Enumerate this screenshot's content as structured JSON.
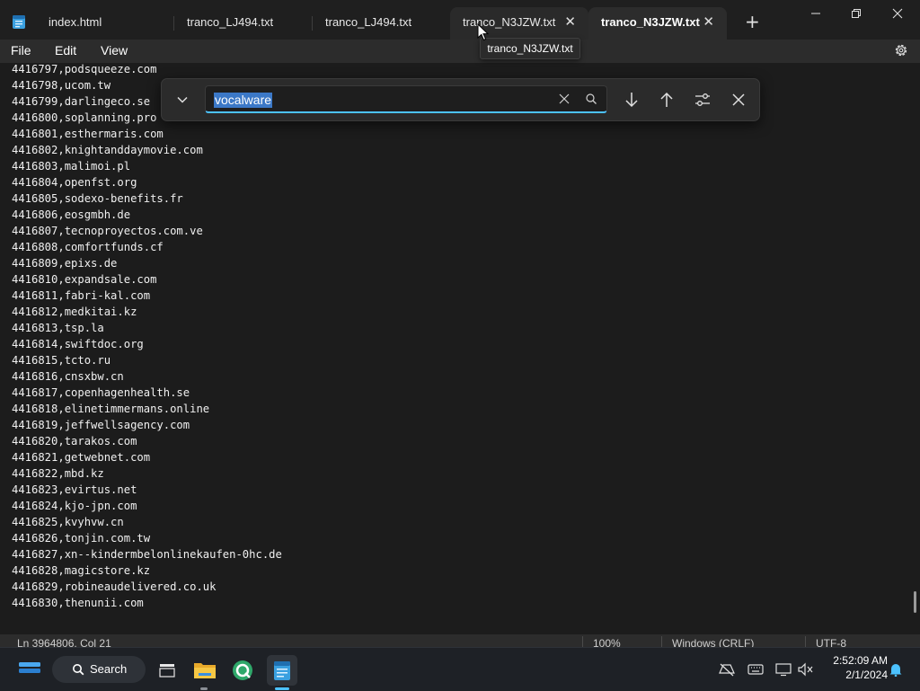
{
  "tabs": [
    {
      "label": "index.html"
    },
    {
      "label": "tranco_LJ494.txt"
    },
    {
      "label": "tranco_LJ494.txt"
    },
    {
      "label": "tranco_N3JZW.txt"
    },
    {
      "label": "tranco_N3JZW.txt"
    }
  ],
  "tooltip": "tranco_N3JZW.txt",
  "menu": {
    "file": "File",
    "edit": "Edit",
    "view": "View"
  },
  "find": {
    "query": "vocalware"
  },
  "lines": [
    "4416797,podsqueeze.com",
    "4416798,ucom.tw",
    "4416799,darlingeco.se",
    "4416800,soplanning.pro",
    "4416801,esthermaris.com",
    "4416802,knightanddaymovie.com",
    "4416803,malimoi.pl",
    "4416804,openfst.org",
    "4416805,sodexo-benefits.fr",
    "4416806,eosgmbh.de",
    "4416807,tecnoproyectos.com.ve",
    "4416808,comfortfunds.cf",
    "4416809,epixs.de",
    "4416810,expandsale.com",
    "4416811,fabri-kal.com",
    "4416812,medkitai.kz",
    "4416813,tsp.la",
    "4416814,swiftdoc.org",
    "4416815,tcto.ru",
    "4416816,cnsxbw.cn",
    "4416817,copenhagenhealth.se",
    "4416818,elinetimmermans.online",
    "4416819,jeffwellsagency.com",
    "4416820,tarakos.com",
    "4416821,getwebnet.com",
    "4416822,mbd.kz",
    "4416823,evirtus.net",
    "4416824,kjo-jpn.com",
    "4416825,kvyhvw.cn",
    "4416826,tonjin.com.tw",
    "4416827,xn--kindermbelonlinekaufen-0hc.de",
    "4416828,magicstore.kz",
    "4416829,robineaudelivered.co.uk",
    "4416830,thenunii.com"
  ],
  "status": {
    "position": "Ln 3964806, Col 21",
    "zoom": "100%",
    "line_ending": "Windows (CRLF)",
    "encoding": "UTF-8"
  },
  "taskbar": {
    "search_label": "Search",
    "time": "2:52:09 AM",
    "date": "2/1/2024"
  },
  "colors": {
    "accent": "#4cc2ff",
    "selection": "#3b78c7",
    "editor_bg": "#1c1c1c"
  }
}
